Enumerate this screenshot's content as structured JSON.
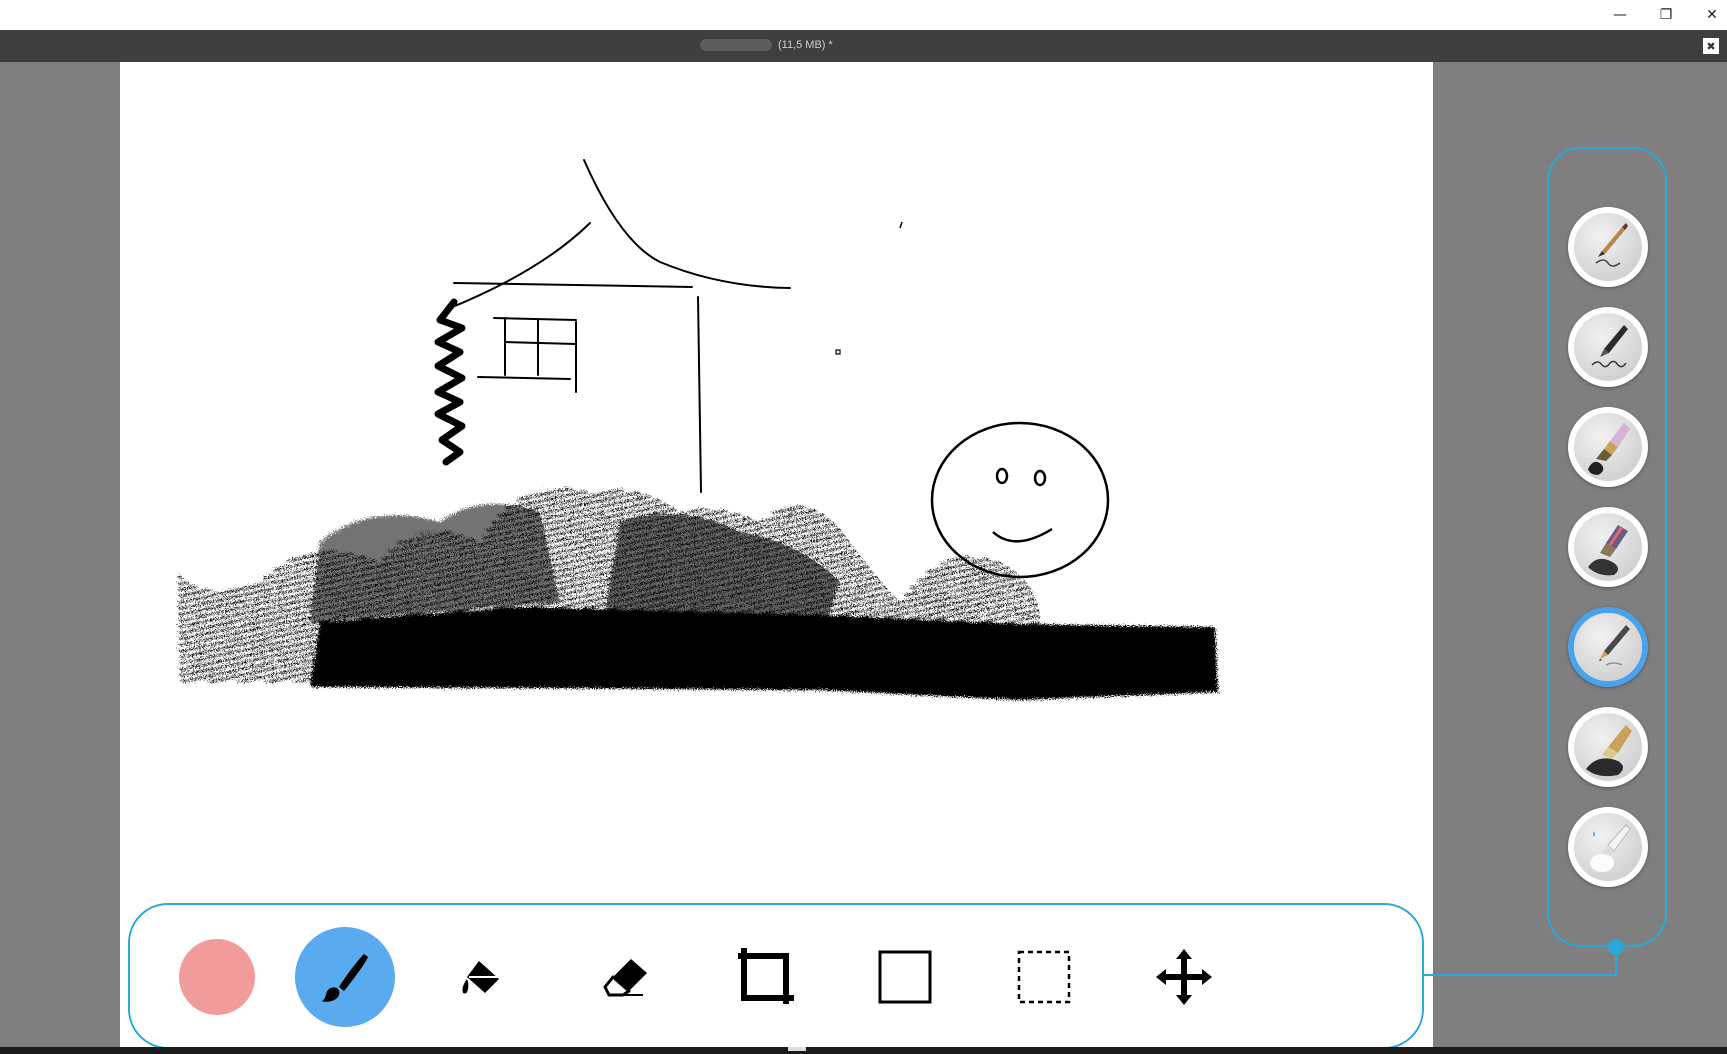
{
  "window": {
    "minimize_glyph": "—",
    "restore_glyph": "❐",
    "close_glyph": "✕"
  },
  "document": {
    "title": "(11,5 MB) *",
    "close_glyph": "✖"
  },
  "toolbar": {
    "tools": [
      {
        "id": "color",
        "icon": "color-swatch",
        "color": "#f29b9b"
      },
      {
        "id": "brush",
        "icon": "paintbrush-icon",
        "active": true,
        "active_color": "#5aaaf0"
      },
      {
        "id": "fill",
        "icon": "paint-bucket-icon"
      },
      {
        "id": "eraser",
        "icon": "eraser-icon"
      },
      {
        "id": "crop",
        "icon": "crop-icon"
      },
      {
        "id": "rectangle",
        "icon": "rectangle-icon"
      },
      {
        "id": "selection",
        "icon": "marquee-selection-icon"
      },
      {
        "id": "move",
        "icon": "move-arrows-icon"
      }
    ]
  },
  "brush_presets": [
    {
      "icon": "fine-brush-icon",
      "selected": false
    },
    {
      "icon": "ink-pen-icon",
      "selected": false
    },
    {
      "icon": "wide-brush-icon",
      "selected": false
    },
    {
      "icon": "marker-icon",
      "selected": false
    },
    {
      "icon": "pencil-icon",
      "selected": true
    },
    {
      "icon": "charcoal-icon",
      "selected": false
    },
    {
      "icon": "watercolor-icon",
      "selected": false
    }
  ],
  "colors": {
    "accent": "#2aa8d8",
    "selected_ring": "#4aa3ea",
    "workspace": "#7f7f7f",
    "docbar": "#3e3e3e"
  }
}
